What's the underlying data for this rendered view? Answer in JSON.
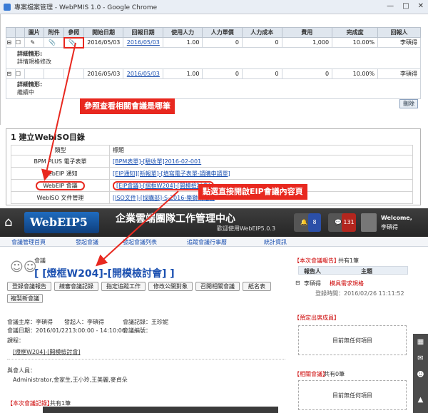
{
  "window": {
    "title": "專案檔案管理 - WebPMIS 1.0 - Google Chrome"
  },
  "top_table": {
    "headers": [
      "",
      "",
      "圖片",
      "附件",
      "參照",
      "開始日期",
      "回報日期",
      "使用人力",
      "人力單價",
      "人力成本",
      "費用",
      "完成度",
      "回報人"
    ],
    "rows": [
      {
        "start": "2016/05/03",
        "report": "2016/05/03",
        "manpower": "1.00",
        "unit": "0",
        "cost": "0",
        "fee": "1,000",
        "progress": "10.00%",
        "reporter": "李碩得",
        "desc_label": "詳細情形:",
        "desc": "詳情規格修改"
      },
      {
        "start": "2016/05/03",
        "report": "2016/05/03",
        "manpower": "1.00",
        "unit": "0",
        "cost": "0",
        "fee": "0",
        "progress": "10.00%",
        "reporter": "李碩得",
        "desc_label": "詳細情形:",
        "desc": "繼續中"
      }
    ],
    "delete_label": "刪除"
  },
  "annotations": {
    "a1": "參照查看相關會議是哪筆",
    "a2": "點選直接開啟EIP會議內容頁"
  },
  "section2": {
    "title": "1 建立WebISO目錄",
    "headers": [
      "類型",
      "標題"
    ],
    "rows": [
      {
        "type": "BPM PLUS 電子表單",
        "title": "[BPM表單]-[驗收單]2016-02-001"
      },
      {
        "type": "WebEIP 通知",
        "title": "[EIP通知][新報單]-[填寫電子表單-請購申請單]"
      },
      {
        "type": "WebEIP 會議",
        "title": "[EIP會議]-[摺框W204]-[開模檢討會]"
      },
      {
        "type": "WebISO 文件管理",
        "title": "[ISO文件]-[採購部]-S-2016-樂獅規格書"
      }
    ]
  },
  "header": {
    "logo": "WebEIP5",
    "title": "企業雲端團隊工作管理中心",
    "welcome": "歡迎使用WebEIP5.0.3",
    "badges": [
      "8",
      "131"
    ],
    "user_welcome": "Welcome,",
    "user": "李碩得"
  },
  "nav": [
    "會議管理首頁",
    "發起會議",
    "發起會議列表",
    "追蹤會議行事曆",
    "統計資訊"
  ],
  "meeting": {
    "section_label": "會議",
    "title": "[ [燈框W204]-[開模檢討會] ]",
    "buttons": [
      "登錄會議報告",
      "線審會議記錄",
      "指定追蹤工作",
      "修改公開對象",
      "召開相關會議",
      "紙名表",
      "複製新會議"
    ],
    "host_label": "會議主席：",
    "host": "李碩得",
    "initiator_label": "發起人：",
    "initiator": "李碩得",
    "recorder_label": "會議記錄：",
    "recorder": "王珍妮",
    "date_label": "會議日期：",
    "date": "2016/01/2213:00:00 - 14:10:00",
    "code_label": "會議編號：",
    "course_label": "課程：",
    "course_link": "[燈框W204]-[開模檢討會]",
    "attendees_label": "與會人員：",
    "attendees": "Administrator,金家生,王小玲,王美麗,麥貞朵",
    "records_label": "【本次會議記錄】",
    "records_count": "共有1筆"
  },
  "right": {
    "report_title": "【本次會議報告】",
    "report_count": "共有1筆",
    "report_headers": [
      "報告人",
      "主題"
    ],
    "report_row": {
      "reporter": "李碩得",
      "topic": "模具需求規格",
      "time_label": "登錄時間：",
      "time": "2016/02/26 11:11:52"
    },
    "pending_title": "【預定出席成員】",
    "pending_empty": "目前無任何項目",
    "related_title": "【相關會議】",
    "related_count": "共有0筆",
    "related_empty": "目前無任何項目"
  }
}
